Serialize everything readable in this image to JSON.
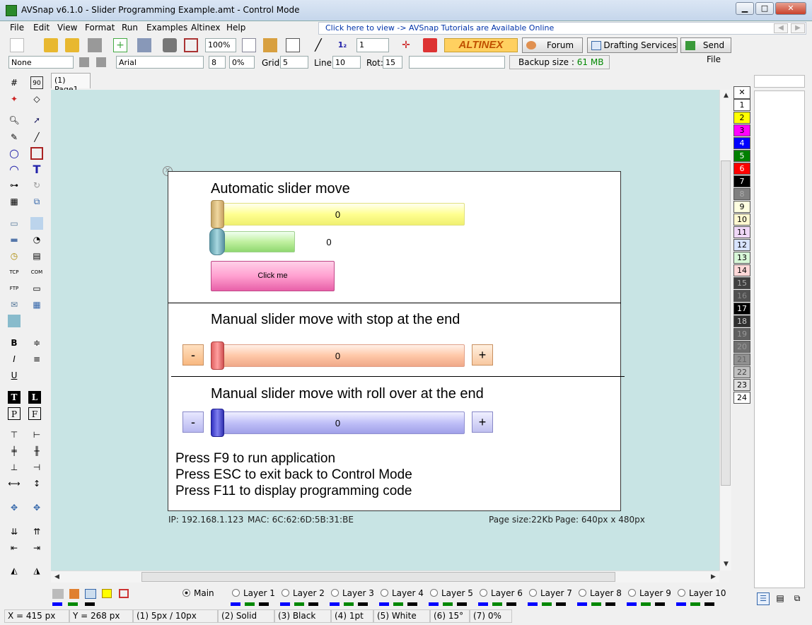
{
  "window": {
    "title": "AVSnap v6.1.0 - Slider Programming Example.amt - Control Mode"
  },
  "menu": [
    "File",
    "Edit",
    "View",
    "Format",
    "Run",
    "Examples",
    "Altinex",
    "Help"
  ],
  "tutorial_link": "Click here to view -> AVSnap Tutorials are Available Online",
  "toolbar1": {
    "zoom": "100%",
    "line_width": "1",
    "altinex_logo": "ALTINEX",
    "forum": "Forum",
    "drafting": "Drafting Services",
    "send_file": "Send File"
  },
  "toolbar2": {
    "style": "None",
    "font": "Arial",
    "font_size": "8",
    "percent": "0%",
    "grid_label": "Grid:",
    "grid": "5",
    "line_label": "Line:",
    "line": "10",
    "rot_label": "Rot:",
    "rot": "15",
    "backup_label": "Backup size :",
    "backup_value": "61 MB"
  },
  "tab": "(1) Page1",
  "page": {
    "section1_title": "Automatic slider move",
    "slider1_value": "0",
    "slider2_value": "0",
    "click_button": "Click me",
    "section2_title": "Manual slider move with stop at the end",
    "slider3_value": "0",
    "section3_title": "Manual slider move with roll over at the end",
    "slider4_value": "0",
    "minus": "-",
    "plus": "+",
    "instructions": [
      "Press F9 to run application",
      "Press ESC to exit back to Control Mode",
      "Press F11 to display programming code"
    ]
  },
  "page_info": {
    "ip": "IP: 192.168.1.123",
    "mac": "MAC: 6C:62:6D:5B:31:BE",
    "page_size": "Page size:22Kb",
    "page_dims": "Page: 640px x 480px"
  },
  "palette": [
    {
      "label": "1",
      "color": "#ffffff",
      "text": "#000"
    },
    {
      "label": "2",
      "color": "#ffff00",
      "text": "#000"
    },
    {
      "label": "3",
      "color": "#ff00ff",
      "text": "#000"
    },
    {
      "label": "4",
      "color": "#0000ff",
      "text": "#fff"
    },
    {
      "label": "5",
      "color": "#008000",
      "text": "#fff"
    },
    {
      "label": "6",
      "color": "#ff0000",
      "text": "#fff"
    },
    {
      "label": "7",
      "color": "#000000",
      "text": "#fff"
    },
    {
      "label": "8",
      "color": "#808080",
      "text": "#aaa"
    },
    {
      "label": "9",
      "color": "#ffffe0",
      "text": "#000"
    },
    {
      "label": "10",
      "color": "#fff8d0",
      "text": "#000"
    },
    {
      "label": "11",
      "color": "#f0d8f8",
      "text": "#000"
    },
    {
      "label": "12",
      "color": "#d8e4ff",
      "text": "#000"
    },
    {
      "label": "13",
      "color": "#d8f8d8",
      "text": "#000"
    },
    {
      "label": "14",
      "color": "#ffd8d8",
      "text": "#000"
    },
    {
      "label": "15",
      "color": "#404040",
      "text": "#aaa"
    },
    {
      "label": "16",
      "color": "#505050",
      "text": "#888"
    },
    {
      "label": "17",
      "color": "#000000",
      "text": "#fff"
    },
    {
      "label": "18",
      "color": "#303030",
      "text": "#ccc"
    },
    {
      "label": "19",
      "color": "#606060",
      "text": "#999"
    },
    {
      "label": "20",
      "color": "#707070",
      "text": "#999"
    },
    {
      "label": "21",
      "color": "#909090",
      "text": "#666"
    },
    {
      "label": "22",
      "color": "#c0c0c0",
      "text": "#444"
    },
    {
      "label": "23",
      "color": "#e0e0e0",
      "text": "#000"
    },
    {
      "label": "24",
      "color": "#ffffff",
      "text": "#000"
    }
  ],
  "layers": [
    "Main",
    "Layer 1",
    "Layer 2",
    "Layer 3",
    "Layer 4",
    "Layer 5",
    "Layer 6",
    "Layer 7",
    "Layer 8",
    "Layer 9",
    "Layer 10"
  ],
  "status": {
    "x": "X = 415 px",
    "y": "Y = 268 px",
    "s1": "(1) 5px / 10px",
    "s2": "(2) Solid",
    "s3": "(3) Black",
    "s4": "(4) 1pt",
    "s5": "(5) White",
    "s6": "(6) 15°",
    "s7": "(7) 0%"
  }
}
